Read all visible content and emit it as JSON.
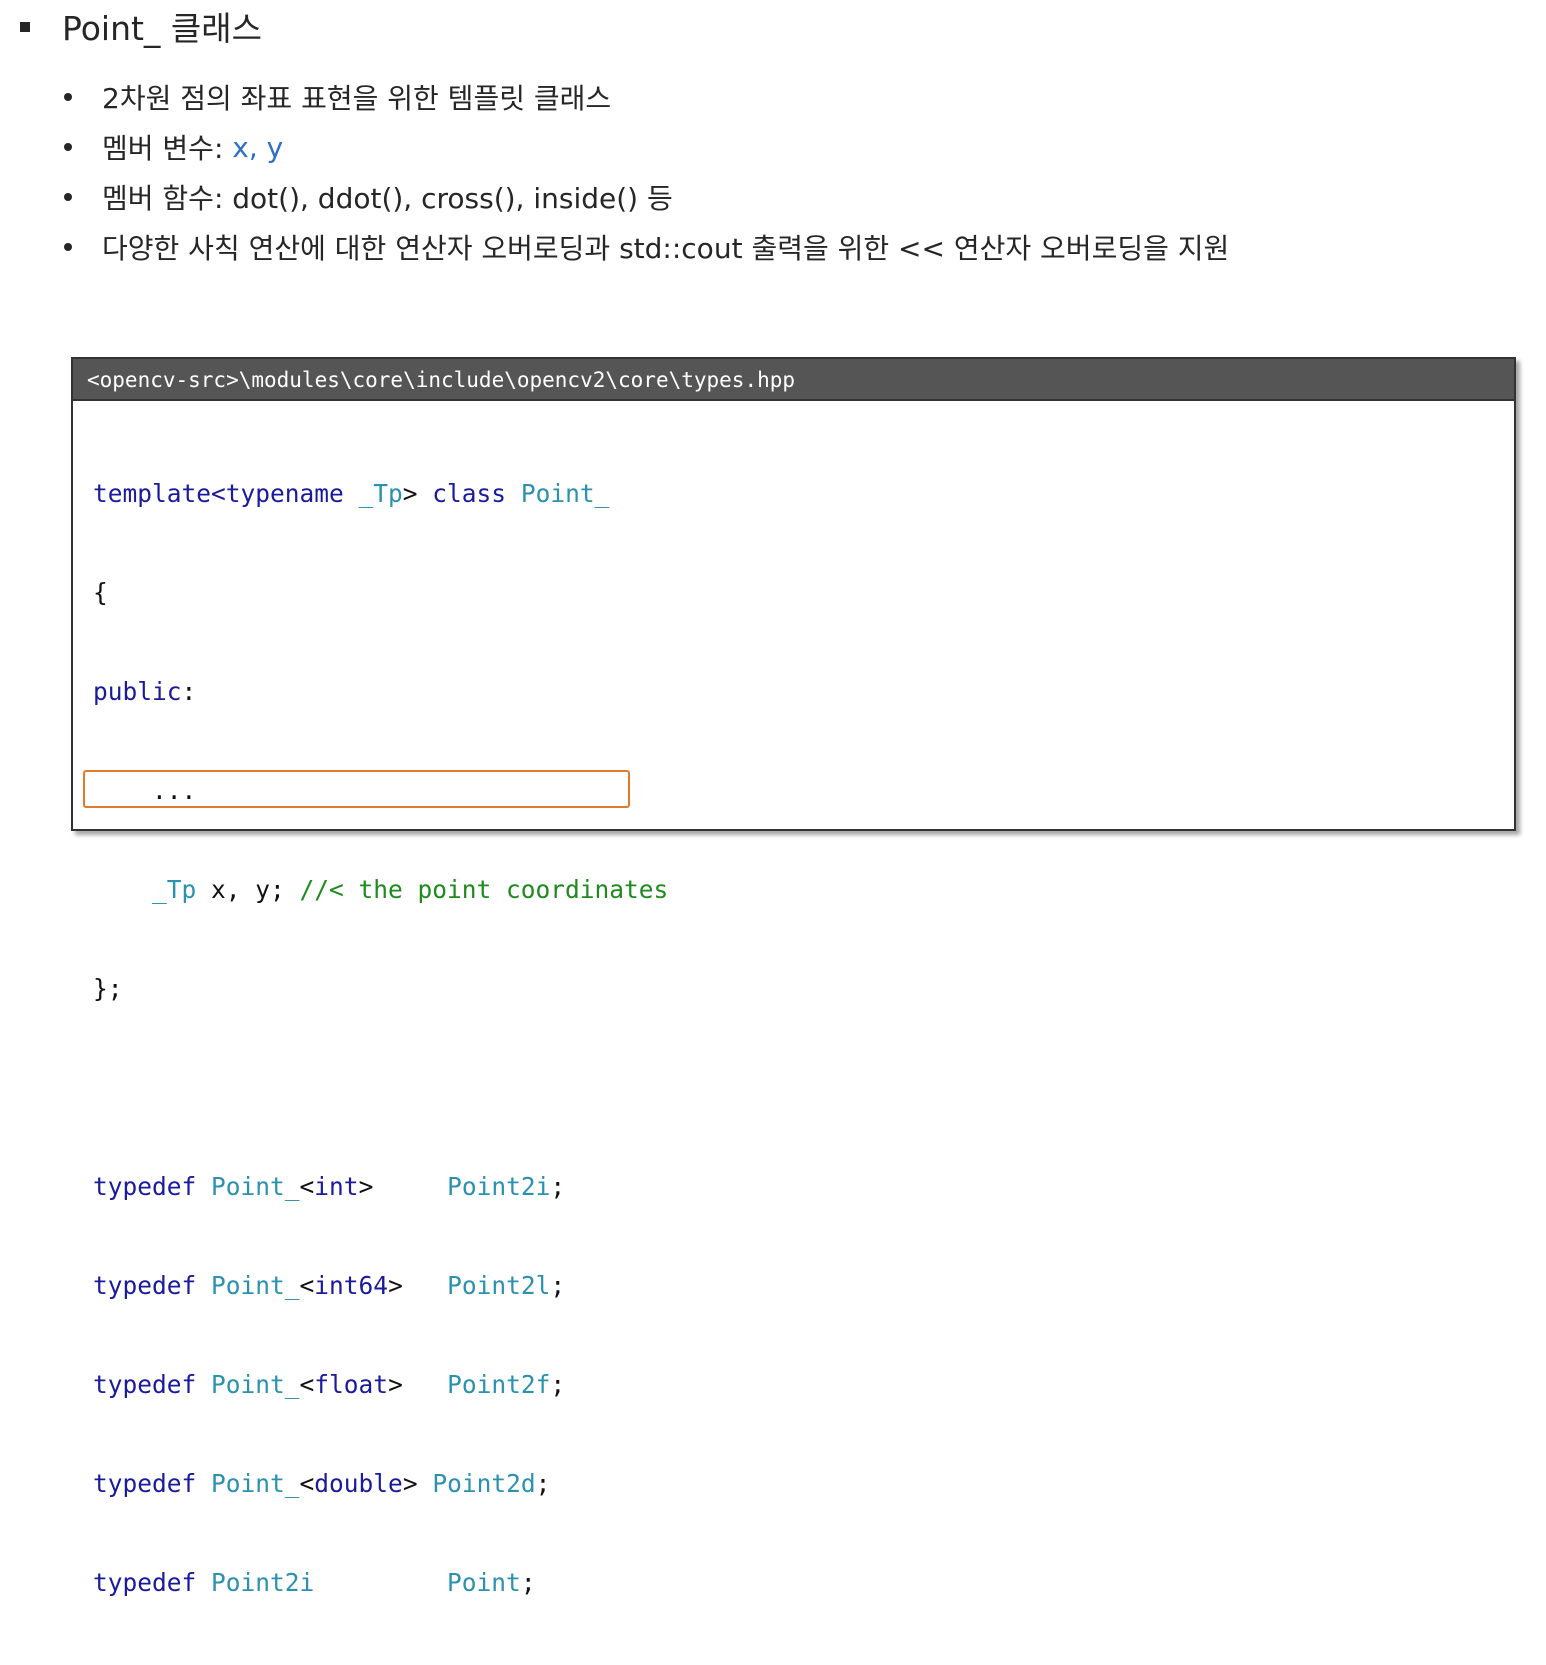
{
  "heading": "Point_ 클래스",
  "bullets": [
    {
      "text": "2차원 점의 좌표 표현을 위한 템플릿 클래스"
    },
    {
      "text": "멤버 변수: ",
      "accent": "x, y"
    },
    {
      "text": "멤버 함수: dot(), ddot(), cross(), inside() 등"
    },
    {
      "text": "다양한 사칙 연산에 대한 연산자 오버로딩과 std::cout 출력을 위한 << 연산자 오버로딩을 지원"
    }
  ],
  "code_box": {
    "path": "<opencv-src>\\modules\\core\\include\\opencv2\\core\\types.hpp",
    "tokens": {
      "t1_kw": "template<typename ",
      "t1_ty": "_Tp",
      "t1_mid": "> ",
      "t1_kw2": "class ",
      "t1_ty2": "Point_",
      "open_brace": "{",
      "public_kw": "public",
      "public_colon": ":",
      "ellipsis": "    ...",
      "tp_indent": "    ",
      "tp_ty": "_Tp",
      "tp_vars": " x, y; ",
      "tp_comment": "//< the point coordinates",
      "close_brace": "};",
      "typedef_kw": "typedef ",
      "r1_ty": "Point_",
      "r1_tmpl_open": "<",
      "r1_tmpl_kw": "int",
      "r1_tmpl_close": ">     ",
      "r1_name": "Point2i",
      "r2_ty": "Point_",
      "r2_tmpl_open": "<",
      "r2_tmpl_kw": "int64",
      "r2_tmpl_close": ">   ",
      "r2_name": "Point2l",
      "r3_ty": "Point_",
      "r3_tmpl_open": "<",
      "r3_tmpl_kw": "float",
      "r3_tmpl_close": ">   ",
      "r3_name": "Point2f",
      "r4_ty": "Point_",
      "r4_tmpl_open": "<",
      "r4_tmpl_kw": "double",
      "r4_tmpl_close": "> ",
      "r4_name": "Point2d",
      "r5_ty": "Point2i",
      "r5_gap": "         ",
      "r5_name": "Point",
      "semi": ";"
    }
  },
  "colors": {
    "keyword": "#1a1a9c",
    "type": "#2b91af",
    "comment": "#1f8a1f",
    "accent": "#2f6fc4",
    "highlight_border": "#e07b2a",
    "header_bg": "#555555"
  }
}
